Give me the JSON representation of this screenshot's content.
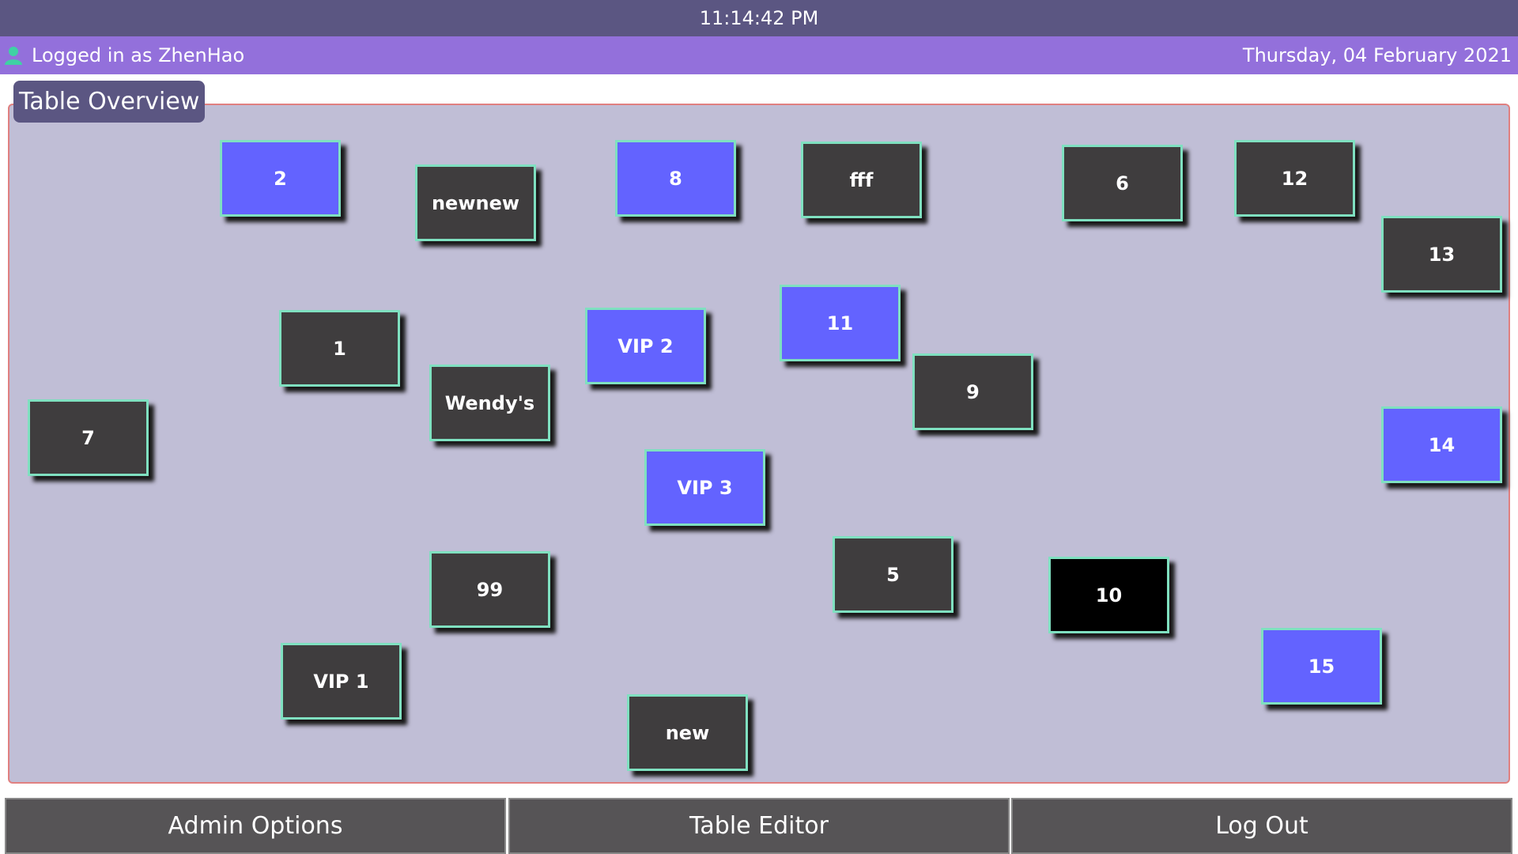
{
  "header": {
    "time": "11:14:42 PM",
    "user_label": "Logged in as ZhenHao",
    "date": "Thursday, 04 February 2021",
    "user_icon": "user-icon"
  },
  "overview": {
    "title": "Table Overview"
  },
  "tables": [
    {
      "label": "2",
      "status": "occupied"
    },
    {
      "label": "newnew",
      "status": "free"
    },
    {
      "label": "8",
      "status": "occupied"
    },
    {
      "label": "fff",
      "status": "free"
    },
    {
      "label": "6",
      "status": "free"
    },
    {
      "label": "12",
      "status": "free"
    },
    {
      "label": "13",
      "status": "free"
    },
    {
      "label": "1",
      "status": "free"
    },
    {
      "label": "VIP 2",
      "status": "occupied"
    },
    {
      "label": "11",
      "status": "occupied"
    },
    {
      "label": "Wendy's",
      "status": "free"
    },
    {
      "label": "9",
      "status": "free"
    },
    {
      "label": "7",
      "status": "free"
    },
    {
      "label": "14",
      "status": "occupied"
    },
    {
      "label": "VIP 3",
      "status": "occupied"
    },
    {
      "label": "5",
      "status": "free"
    },
    {
      "label": "99",
      "status": "free"
    },
    {
      "label": "10",
      "status": "selected"
    },
    {
      "label": "15",
      "status": "occupied"
    },
    {
      "label": "VIP 1",
      "status": "free"
    },
    {
      "label": "new",
      "status": "free"
    }
  ],
  "footer": {
    "admin_label": "Admin Options",
    "editor_label": "Table Editor",
    "logout_label": "Log Out"
  },
  "colors": {
    "header_bar": "#5b5682",
    "user_bar": "#9370db",
    "overview_bg": "#c0bed6",
    "table_free": "#3f3d3e",
    "table_occupied": "#6363ff",
    "table_selected": "#000000",
    "table_border": "#7fe0c0"
  }
}
